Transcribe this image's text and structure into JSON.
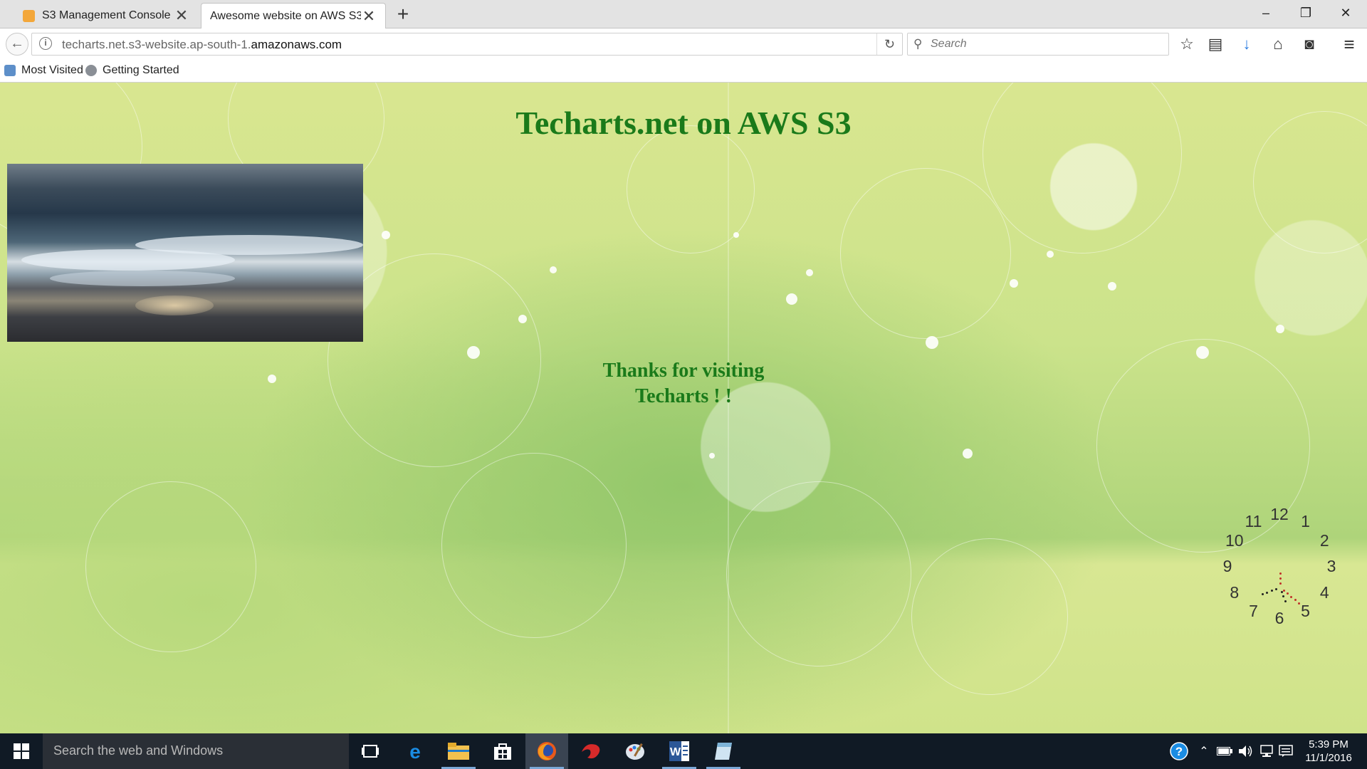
{
  "browser": {
    "tabs": [
      {
        "label": "S3 Management Console",
        "active": false
      },
      {
        "label": "Awesome website on AWS S3",
        "active": true
      }
    ],
    "url_prefix": "techarts.net.s3-website.ap-south-1.",
    "url_host": "amazonaws.com",
    "search_placeholder": "Search",
    "bookmarks": [
      "Most Visited",
      "Getting Started"
    ],
    "icons": {
      "new_tab": "+",
      "minimize": "–",
      "restore": "❐",
      "close": "✕",
      "back": "←",
      "reload": "↻",
      "search": "⚲",
      "bookmark_star": "☆",
      "reading_list": "▤",
      "downloads": "↓",
      "home": "⌂",
      "pocket": "◙",
      "menu": "≡"
    }
  },
  "page": {
    "title": "Techarts.net on AWS S3",
    "thanks_line1": "Thanks for visiting",
    "thanks_line2": "Techarts ! !",
    "clock_numbers": [
      "12",
      "1",
      "2",
      "3",
      "4",
      "5",
      "6",
      "7",
      "8",
      "9",
      "10",
      "11"
    ]
  },
  "taskbar": {
    "search_text": "Search the web and Windows",
    "time": "5:39 PM",
    "date": "11/1/2016",
    "apps": [
      "task-view",
      "edge",
      "file-explorer",
      "store",
      "firefox",
      "app-red",
      "app-paint",
      "word",
      "app-notes"
    ]
  },
  "colors": {
    "title_green": "#1a7a1a",
    "taskbar_bg": "#101a25",
    "download_blue": "#2a7ce0"
  }
}
